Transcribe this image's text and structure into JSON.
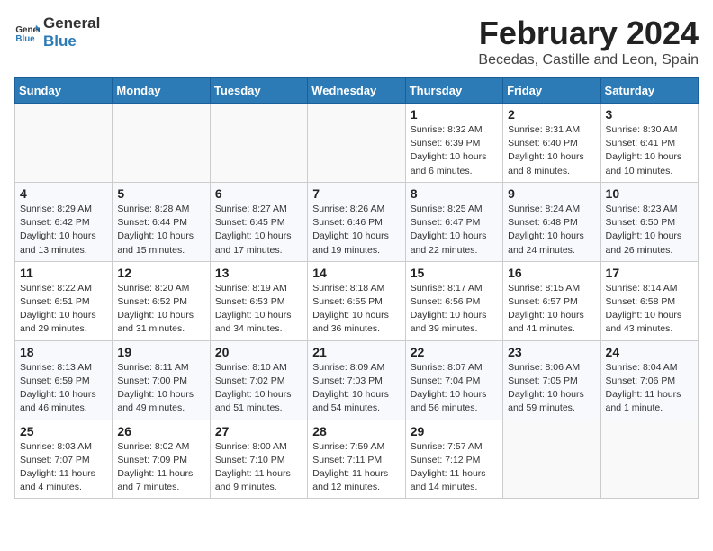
{
  "header": {
    "logo_line1": "General",
    "logo_line2": "Blue",
    "month": "February 2024",
    "location": "Becedas, Castille and Leon, Spain"
  },
  "weekdays": [
    "Sunday",
    "Monday",
    "Tuesday",
    "Wednesday",
    "Thursday",
    "Friday",
    "Saturday"
  ],
  "weeks": [
    [
      {
        "day": "",
        "info": ""
      },
      {
        "day": "",
        "info": ""
      },
      {
        "day": "",
        "info": ""
      },
      {
        "day": "",
        "info": ""
      },
      {
        "day": "1",
        "info": "Sunrise: 8:32 AM\nSunset: 6:39 PM\nDaylight: 10 hours\nand 6 minutes."
      },
      {
        "day": "2",
        "info": "Sunrise: 8:31 AM\nSunset: 6:40 PM\nDaylight: 10 hours\nand 8 minutes."
      },
      {
        "day": "3",
        "info": "Sunrise: 8:30 AM\nSunset: 6:41 PM\nDaylight: 10 hours\nand 10 minutes."
      }
    ],
    [
      {
        "day": "4",
        "info": "Sunrise: 8:29 AM\nSunset: 6:42 PM\nDaylight: 10 hours\nand 13 minutes."
      },
      {
        "day": "5",
        "info": "Sunrise: 8:28 AM\nSunset: 6:44 PM\nDaylight: 10 hours\nand 15 minutes."
      },
      {
        "day": "6",
        "info": "Sunrise: 8:27 AM\nSunset: 6:45 PM\nDaylight: 10 hours\nand 17 minutes."
      },
      {
        "day": "7",
        "info": "Sunrise: 8:26 AM\nSunset: 6:46 PM\nDaylight: 10 hours\nand 19 minutes."
      },
      {
        "day": "8",
        "info": "Sunrise: 8:25 AM\nSunset: 6:47 PM\nDaylight: 10 hours\nand 22 minutes."
      },
      {
        "day": "9",
        "info": "Sunrise: 8:24 AM\nSunset: 6:48 PM\nDaylight: 10 hours\nand 24 minutes."
      },
      {
        "day": "10",
        "info": "Sunrise: 8:23 AM\nSunset: 6:50 PM\nDaylight: 10 hours\nand 26 minutes."
      }
    ],
    [
      {
        "day": "11",
        "info": "Sunrise: 8:22 AM\nSunset: 6:51 PM\nDaylight: 10 hours\nand 29 minutes."
      },
      {
        "day": "12",
        "info": "Sunrise: 8:20 AM\nSunset: 6:52 PM\nDaylight: 10 hours\nand 31 minutes."
      },
      {
        "day": "13",
        "info": "Sunrise: 8:19 AM\nSunset: 6:53 PM\nDaylight: 10 hours\nand 34 minutes."
      },
      {
        "day": "14",
        "info": "Sunrise: 8:18 AM\nSunset: 6:55 PM\nDaylight: 10 hours\nand 36 minutes."
      },
      {
        "day": "15",
        "info": "Sunrise: 8:17 AM\nSunset: 6:56 PM\nDaylight: 10 hours\nand 39 minutes."
      },
      {
        "day": "16",
        "info": "Sunrise: 8:15 AM\nSunset: 6:57 PM\nDaylight: 10 hours\nand 41 minutes."
      },
      {
        "day": "17",
        "info": "Sunrise: 8:14 AM\nSunset: 6:58 PM\nDaylight: 10 hours\nand 43 minutes."
      }
    ],
    [
      {
        "day": "18",
        "info": "Sunrise: 8:13 AM\nSunset: 6:59 PM\nDaylight: 10 hours\nand 46 minutes."
      },
      {
        "day": "19",
        "info": "Sunrise: 8:11 AM\nSunset: 7:00 PM\nDaylight: 10 hours\nand 49 minutes."
      },
      {
        "day": "20",
        "info": "Sunrise: 8:10 AM\nSunset: 7:02 PM\nDaylight: 10 hours\nand 51 minutes."
      },
      {
        "day": "21",
        "info": "Sunrise: 8:09 AM\nSunset: 7:03 PM\nDaylight: 10 hours\nand 54 minutes."
      },
      {
        "day": "22",
        "info": "Sunrise: 8:07 AM\nSunset: 7:04 PM\nDaylight: 10 hours\nand 56 minutes."
      },
      {
        "day": "23",
        "info": "Sunrise: 8:06 AM\nSunset: 7:05 PM\nDaylight: 10 hours\nand 59 minutes."
      },
      {
        "day": "24",
        "info": "Sunrise: 8:04 AM\nSunset: 7:06 PM\nDaylight: 11 hours\nand 1 minute."
      }
    ],
    [
      {
        "day": "25",
        "info": "Sunrise: 8:03 AM\nSunset: 7:07 PM\nDaylight: 11 hours\nand 4 minutes."
      },
      {
        "day": "26",
        "info": "Sunrise: 8:02 AM\nSunset: 7:09 PM\nDaylight: 11 hours\nand 7 minutes."
      },
      {
        "day": "27",
        "info": "Sunrise: 8:00 AM\nSunset: 7:10 PM\nDaylight: 11 hours\nand 9 minutes."
      },
      {
        "day": "28",
        "info": "Sunrise: 7:59 AM\nSunset: 7:11 PM\nDaylight: 11 hours\nand 12 minutes."
      },
      {
        "day": "29",
        "info": "Sunrise: 7:57 AM\nSunset: 7:12 PM\nDaylight: 11 hours\nand 14 minutes."
      },
      {
        "day": "",
        "info": ""
      },
      {
        "day": "",
        "info": ""
      }
    ]
  ]
}
